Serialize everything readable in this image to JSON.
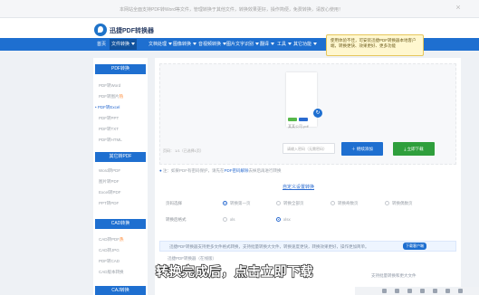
{
  "notice": {
    "text": "本网站全面支持PDF转Word等文件，管理转换于其他文件，转换效果更好，操作简便，免费转换，请放心使用！"
  },
  "header": {
    "logo_text": "迅捷PDF转换器"
  },
  "nav": {
    "items": [
      {
        "label": "首页",
        "active": false
      },
      {
        "label": "文件转换",
        "active": true
      },
      {
        "label": "文档处理",
        "active": false
      },
      {
        "label": "图像转换",
        "active": false
      },
      {
        "label": "音视频转换",
        "active": false
      },
      {
        "label": "图片文字识别",
        "active": false
      },
      {
        "label": "翻译",
        "active": false
      },
      {
        "label": "工具",
        "active": false
      },
      {
        "label": "其它功能",
        "active": false
      }
    ],
    "tooltip": "使用体验不佳，可安装迅捷PDF转换器本地客户端，转换更快、效果更好、更多功能"
  },
  "sidebar": {
    "sections": [
      {
        "title": "PDF转换",
        "items": [
          {
            "label": "PDF转Word",
            "hot": false,
            "selected": false
          },
          {
            "label": "PDF转图片",
            "hot": true,
            "selected": false
          },
          {
            "label": "PDF转Excel",
            "hot": false,
            "selected": true
          },
          {
            "label": "PDF转PPT",
            "hot": false,
            "selected": false
          },
          {
            "label": "PDF转TXT",
            "hot": false,
            "selected": false
          },
          {
            "label": "PDF转HTML",
            "hot": false,
            "selected": false
          }
        ]
      },
      {
        "title": "其它转PDF",
        "items": [
          {
            "label": "Word转PDF",
            "hot": false,
            "selected": false
          },
          {
            "label": "图片转PDF",
            "hot": false,
            "selected": false
          },
          {
            "label": "Excel转PDF",
            "hot": false,
            "selected": false
          },
          {
            "label": "PPT转PDF",
            "hot": false,
            "selected": false
          }
        ]
      },
      {
        "title": "CAD转换",
        "items": [
          {
            "label": "CAD转PDF",
            "hot": true,
            "selected": false
          },
          {
            "label": "CAD转JPG",
            "hot": false,
            "selected": false
          },
          {
            "label": "PDF转CAD",
            "hot": false,
            "selected": false
          },
          {
            "label": "CAD版本转换",
            "hot": false,
            "selected": false
          }
        ]
      },
      {
        "title": "CAJ转换",
        "items": []
      }
    ]
  },
  "upload": {
    "file_name": "某某公司.pdf",
    "tag_green": "完成",
    "tag_blue": "设置",
    "pages_text": "页码： 1/1（已选择1页）",
    "password_placeholder": "请输入密码（无需密码）",
    "add_button": "继续添加",
    "download_button": "立即下载"
  },
  "tip": {
    "prefix": "注：如果PDF有密码保护，请先在",
    "link": "PDF密码解除",
    "suffix": "去掉后再进行转换"
  },
  "settings": {
    "title": "自定义设置转换",
    "rows": [
      {
        "label": "页码选择",
        "options": [
          {
            "text": "转换第一页",
            "checked": true
          },
          {
            "text": "转换全部页",
            "checked": false
          },
          {
            "text": "转换奇数页",
            "checked": false
          },
          {
            "text": "转换偶数页",
            "checked": false
          }
        ]
      },
      {
        "label": "转换后格式",
        "options": [
          {
            "text": "xls",
            "checked": false
          },
          {
            "text": "xlsx",
            "checked": true
          }
        ]
      }
    ]
  },
  "promo": {
    "text": "迅捷PDF转换器支持更多文件格式转换，支持批量转换大文件，转换速度更快，转换效果更好，操作更加简单。",
    "button": "下载客户端"
  },
  "bottom": {
    "faint_left": "迅捷PDF转换器（在线版）",
    "faint_right": "支持批量转换和更大文件"
  },
  "subtitle": "转换完成后，点击立即下载"
}
